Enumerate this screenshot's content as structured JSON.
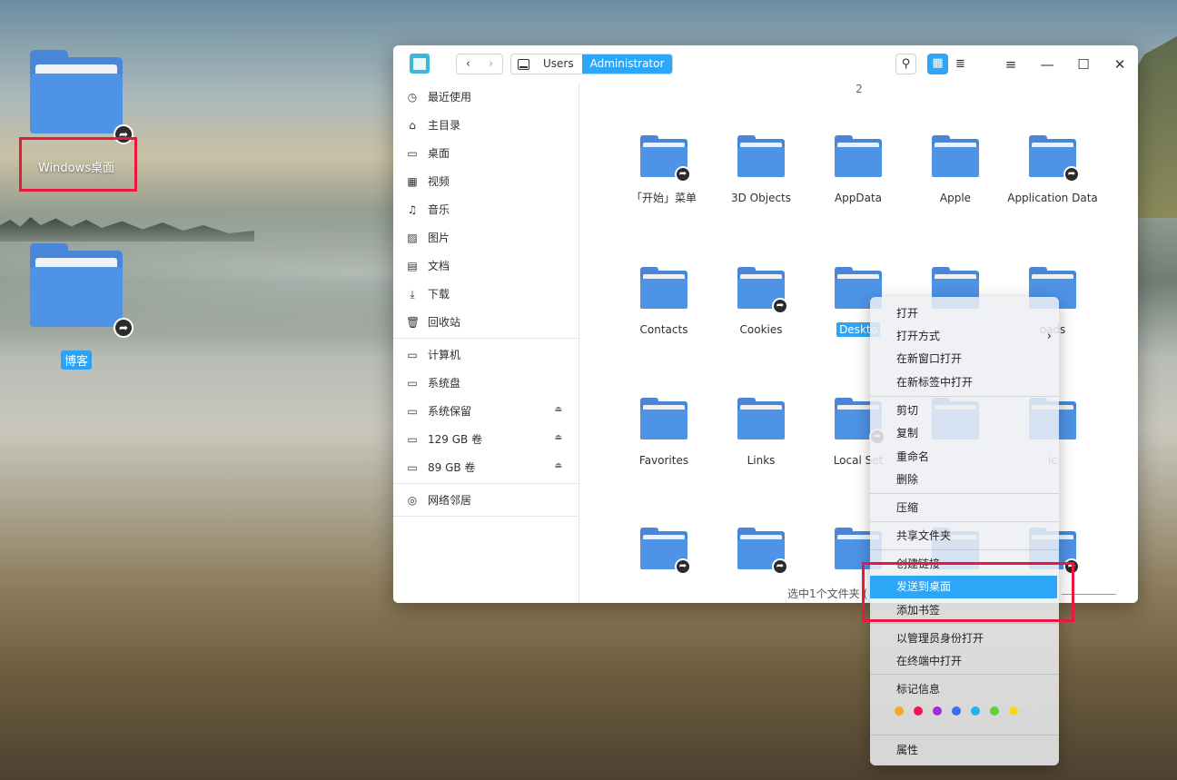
{
  "desktop": {
    "icons": [
      {
        "label": "Windows桌面"
      },
      {
        "label": "博客"
      }
    ]
  },
  "window": {
    "nav": {
      "back": "‹",
      "forward": "›"
    },
    "breadcrumb": [
      "Users",
      "Administrator"
    ],
    "toolbar": {
      "search_icon": "⚲",
      "grid_icon": "▦",
      "list_icon": "≣",
      "menu_icon": "≡",
      "minimize": "—",
      "maximize": "☐",
      "close": "✕"
    }
  },
  "sidebar": {
    "groups": [
      [
        "最近使用",
        "主目录",
        "桌面",
        "视频",
        "音乐",
        "图片",
        "文档",
        "下载",
        "回收站"
      ],
      [
        "计算机",
        "系统盘",
        "系统保留",
        "129 GB 卷",
        "89 GB 卷"
      ],
      [
        "网络邻居"
      ]
    ],
    "icons": [
      "◷",
      "⌂",
      "▭",
      "▦",
      "♫",
      "▨",
      "▤",
      "⤓",
      "🗑",
      "▭",
      "▭",
      "▭",
      "▭",
      "▭",
      "◎"
    ],
    "eject_icon": "⏏"
  },
  "content": {
    "page_label": "2",
    "files": [
      {
        "name": "「开始」菜单",
        "link": true
      },
      {
        "name": "3D Objects",
        "link": false
      },
      {
        "name": "AppData",
        "link": false
      },
      {
        "name": "Apple",
        "link": false
      },
      {
        "name": "Application Data",
        "link": true
      },
      {
        "name": "Contacts",
        "link": false
      },
      {
        "name": "Cookies",
        "link": true
      },
      {
        "name": "Desktop",
        "link": false
      },
      {
        "name": "",
        "link": false
      },
      {
        "name": "Downloads",
        "link": false
      },
      {
        "name": "Favorites",
        "link": false
      },
      {
        "name": "Links",
        "link": false
      },
      {
        "name": "Local Settings",
        "link": true
      },
      {
        "name": "",
        "link": false
      },
      {
        "name": "Music",
        "link": false
      },
      {
        "name": "",
        "link": true
      },
      {
        "name": "",
        "link": true
      },
      {
        "name": "",
        "link": false
      },
      {
        "name": "",
        "link": false
      },
      {
        "name": "",
        "link": true
      }
    ],
    "visible_names": [
      "「开始」菜单",
      "3D Objects",
      "AppData",
      "Apple",
      "Application Data",
      "Contacts",
      "Cookies",
      "Deskto",
      "",
      "oads",
      "Favorites",
      "Links",
      "Local Set",
      "",
      "ic",
      "",
      "",
      "",
      "",
      ""
    ],
    "status": "选中1个文件夹 ("
  },
  "context_menu": {
    "items": [
      "打开",
      "打开方式",
      "在新窗口打开",
      "在新标签中打开",
      "剪切",
      "复制",
      "重命名",
      "删除",
      "压缩",
      "共享文件夹",
      "创建链接",
      "发送到桌面",
      "添加书签",
      "以管理员身份打开",
      "在终端中打开",
      "标记信息",
      "属性"
    ],
    "submenu_arrow": "›",
    "highlighted": "发送到桌面",
    "tag_colors": [
      "#f5a623",
      "#f0174e",
      "#a32de0",
      "#3a6ef0",
      "#1fb3f0",
      "#5fd03a",
      "#f5d81e",
      "#d9d9d9"
    ]
  },
  "colors": {
    "accent": "#2ca7f8",
    "folder": "#4f93e6",
    "annotation": "#e8193c"
  }
}
